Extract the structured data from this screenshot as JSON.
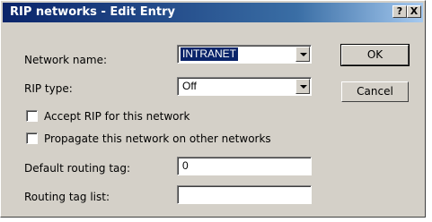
{
  "window": {
    "title": "RIP networks - Edit Entry",
    "help_glyph": "?",
    "close_glyph": "X"
  },
  "fields": {
    "network_name": {
      "label": "Network name:",
      "value": "INTRANET"
    },
    "rip_type": {
      "label": "RIP type:",
      "value": "Off"
    },
    "accept_rip": {
      "label": "Accept RIP for this network",
      "checked": false
    },
    "propagate": {
      "label": "Propagate this network on other networks",
      "checked": false
    },
    "default_routing_tag": {
      "label": "Default routing tag:",
      "value": "0"
    },
    "routing_tag_list": {
      "label": "Routing tag list:",
      "value": ""
    }
  },
  "buttons": {
    "ok": "OK",
    "cancel": "Cancel"
  },
  "colors": {
    "face": "#d4d0c8",
    "title_start": "#0a246a",
    "title_end": "#a6caf0",
    "selection": "#0a246a"
  }
}
